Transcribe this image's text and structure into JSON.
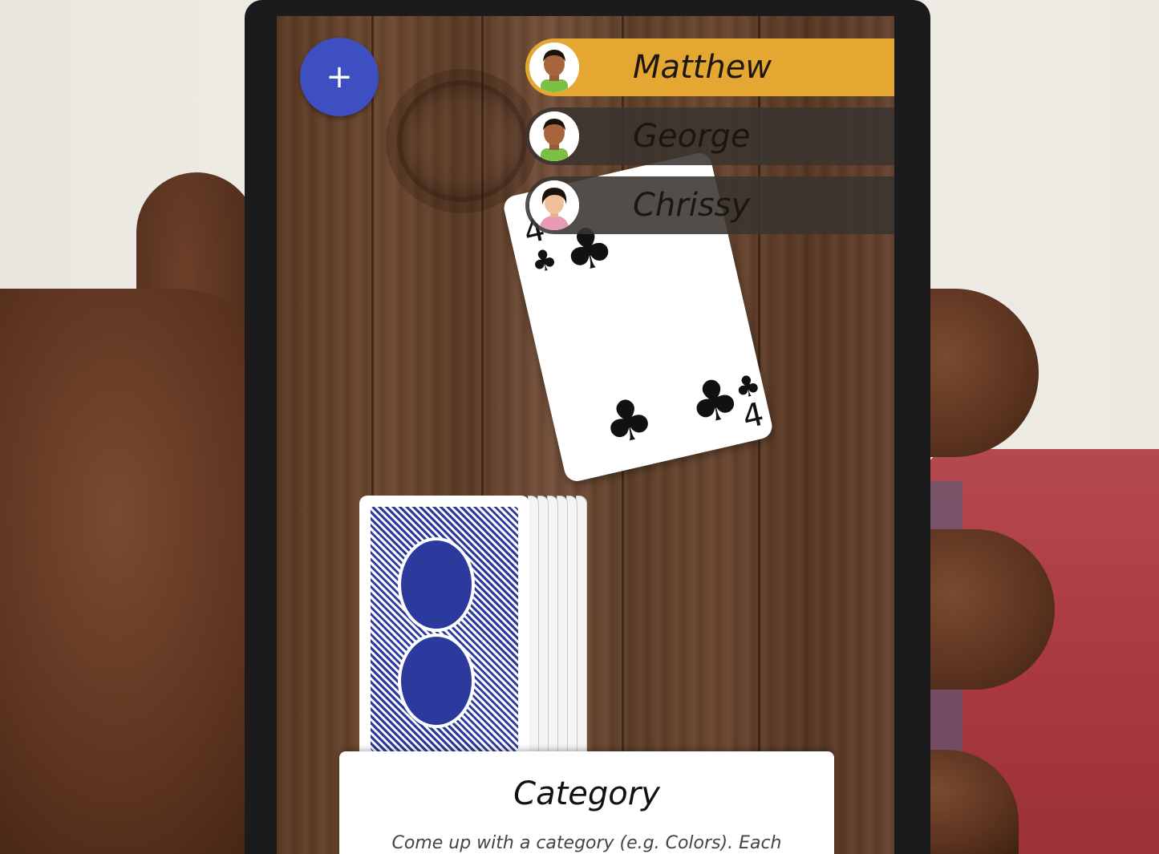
{
  "add_button": {
    "label": "+"
  },
  "players": [
    {
      "name": "Matthew",
      "active": true
    },
    {
      "name": "George",
      "active": false
    },
    {
      "name": "Chrissy",
      "active": false
    }
  ],
  "played_card": {
    "suit": "clubs",
    "suit_symbol": "♣",
    "rank": "4",
    "color": "#111111"
  },
  "deck": {
    "back_color": "#2b3a9c"
  },
  "rule_card": {
    "title": "Category",
    "description": "Come up with a category (e.g. Colors). Each"
  },
  "colors": {
    "accent": "#3e4fc2",
    "active_player": "#e4a731",
    "inactive_player": "#3a3430"
  }
}
